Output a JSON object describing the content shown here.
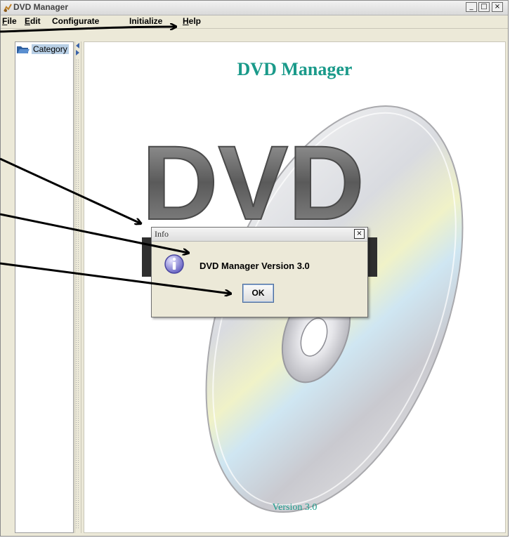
{
  "window": {
    "title": "DVD Manager",
    "buttons": {
      "minimize": "_",
      "maximize": "□",
      "close": "×"
    }
  },
  "menubar": {
    "items": [
      {
        "mnemonic": "F",
        "rest": "ile"
      },
      {
        "mnemonic": "E",
        "rest": "dit"
      },
      {
        "mnemonic": "",
        "rest": "Configurate"
      },
      {
        "mnemonic": "",
        "rest": "Initialize"
      },
      {
        "mnemonic": "H",
        "rest": "elp"
      }
    ]
  },
  "sidebar": {
    "tree_root_label": "Category"
  },
  "main": {
    "heading": "DVD Manager",
    "logo_text": "DVD",
    "footer_version": "Version 3.0"
  },
  "dialog": {
    "title": "Info",
    "close_label": "×",
    "message": "DVD Manager Version 3.0",
    "ok_label": "OK"
  },
  "colors": {
    "heading_teal": "#1a9a8a",
    "tree_selection": "#b8cfe5",
    "dialog_bg": "#ece9d8",
    "info_icon": "#6a66c4"
  },
  "icons": [
    "app-icon",
    "folder-icon",
    "info-icon",
    "close-icon",
    "minimize-icon",
    "maximize-icon"
  ]
}
